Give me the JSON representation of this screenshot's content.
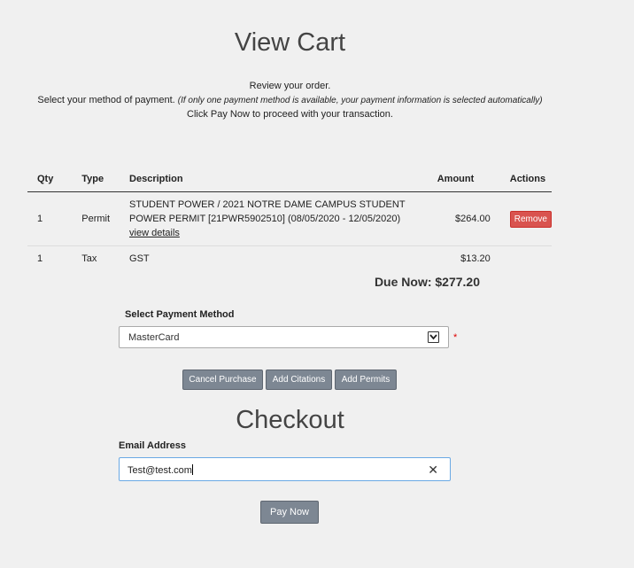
{
  "cart": {
    "title": "View Cart",
    "instructions": {
      "line1": "Review your order.",
      "line2_main": "Select your method of payment.",
      "line2_note": "(If only one payment method is available, your payment information is selected automatically)",
      "line3": "Click Pay Now to proceed with your transaction."
    },
    "columns": {
      "qty": "Qty",
      "type": "Type",
      "description": "Description",
      "amount": "Amount",
      "actions": "Actions"
    },
    "rows": [
      {
        "qty": "1",
        "type": "Permit",
        "description": "STUDENT POWER / 2021 NOTRE DAME CAMPUS STUDENT POWER PERMIT [21PWR5902510] (08/05/2020 - 12/05/2020)",
        "details_link": "view details",
        "amount": "$264.00",
        "action": "Remove"
      },
      {
        "qty": "1",
        "type": "Tax",
        "description": "GST",
        "amount": "$13.20"
      }
    ],
    "due_now": "Due Now: $277.20"
  },
  "payment": {
    "label": "Select Payment Method",
    "selected": "MasterCard",
    "required_mark": "*"
  },
  "buttons": {
    "cancel": "Cancel Purchase",
    "add_citations": "Add Citations",
    "add_permits": "Add Permits",
    "pay_now": "Pay Now"
  },
  "checkout": {
    "title": "Checkout",
    "email_label": "Email Address",
    "email_value": "Test@test.com",
    "clear_glyph": "✕"
  },
  "colors": {
    "background": "#f0f0f0",
    "button": "#7d8793",
    "remove": "#d9534f",
    "focus_border": "#6aa9e4"
  }
}
